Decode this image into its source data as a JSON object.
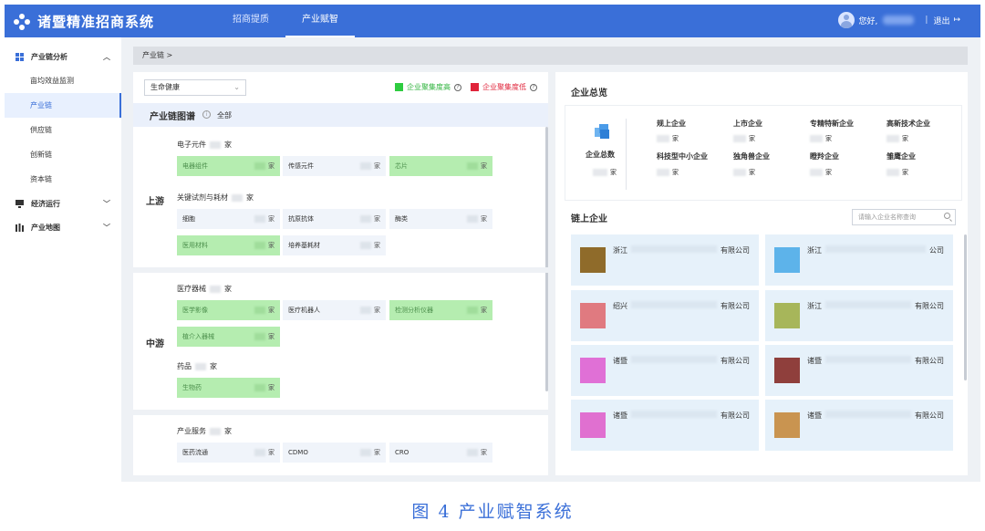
{
  "app": {
    "title": "诸暨精准招商系统"
  },
  "nav": [
    {
      "label": "招商提质",
      "active": false
    },
    {
      "label": "产业赋智",
      "active": true
    }
  ],
  "user": {
    "greeting": "您好,",
    "separator": "|",
    "logout": "退出"
  },
  "sidebar": {
    "group1": "产业链分析",
    "items": [
      "亩均效益监测",
      "产业链",
      "供应链",
      "创新链",
      "资本链"
    ],
    "group2": "经济运行",
    "group3": "产业地图"
  },
  "breadcrumb": "产业链 >",
  "left": {
    "select": "生命健康",
    "legend": {
      "high": "企业聚集度高",
      "low": "企业聚集度低",
      "high_color": "#2ecc40",
      "low_color": "#e0243a"
    },
    "map_title": "产业链图谱",
    "map_all": "全部",
    "unit": "家",
    "upstream": {
      "stage": "上游",
      "cat1": "电子元件",
      "cat1_boxes": [
        "电器组件",
        "传感元件",
        "芯片"
      ],
      "cat2": "关键试剂与耗材",
      "cat2_boxes": [
        "细胞",
        "抗原抗体",
        "酶类",
        "医用材料",
        "培养基耗材"
      ]
    },
    "midstream": {
      "stage": "中游",
      "cat1": "医疗器械",
      "cat1_boxes": [
        "医学影像",
        "医疗机器人",
        "检测分析仪器",
        "植介入器械"
      ],
      "cat2": "药品",
      "cat2_boxes": [
        "生物药"
      ]
    },
    "downstream": {
      "cat1": "产业服务",
      "cat1_boxes": [
        "医药流通",
        "CDMO",
        "CRO"
      ]
    }
  },
  "right": {
    "overview_title": "企业总览",
    "total_label": "企业总数",
    "unit": "家",
    "stats_row1": [
      "规上企业",
      "上市企业",
      "专精特新企业",
      "高新技术企业"
    ],
    "stats_row2": [
      "科技型中小企业",
      "独角兽企业",
      "瞪羚企业",
      "雏鹰企业"
    ],
    "chain_title": "链上企业",
    "search_placeholder": "请输入企业名称查询",
    "companies": [
      {
        "city": "浙江",
        "suffix": "有限公司",
        "color": "#8f6b2a"
      },
      {
        "city": "浙江",
        "suffix": "公司",
        "color": "#5db3ea"
      },
      {
        "city": "绍兴",
        "suffix": "有限公司",
        "color": "#e07a80"
      },
      {
        "city": "浙江",
        "suffix": "有限公司",
        "color": "#a7b65a"
      },
      {
        "city": "诸暨",
        "suffix": "有限公司",
        "color": "#e070d6"
      },
      {
        "city": "诸暨",
        "suffix": "有限公司",
        "color": "#8f3f3c"
      },
      {
        "city": "诸暨",
        "suffix": "有限公司",
        "color": "#e070d0"
      },
      {
        "city": "诸暨",
        "suffix": "有限公司",
        "color": "#c99450"
      }
    ]
  },
  "caption": "图 4    产业赋智系统"
}
